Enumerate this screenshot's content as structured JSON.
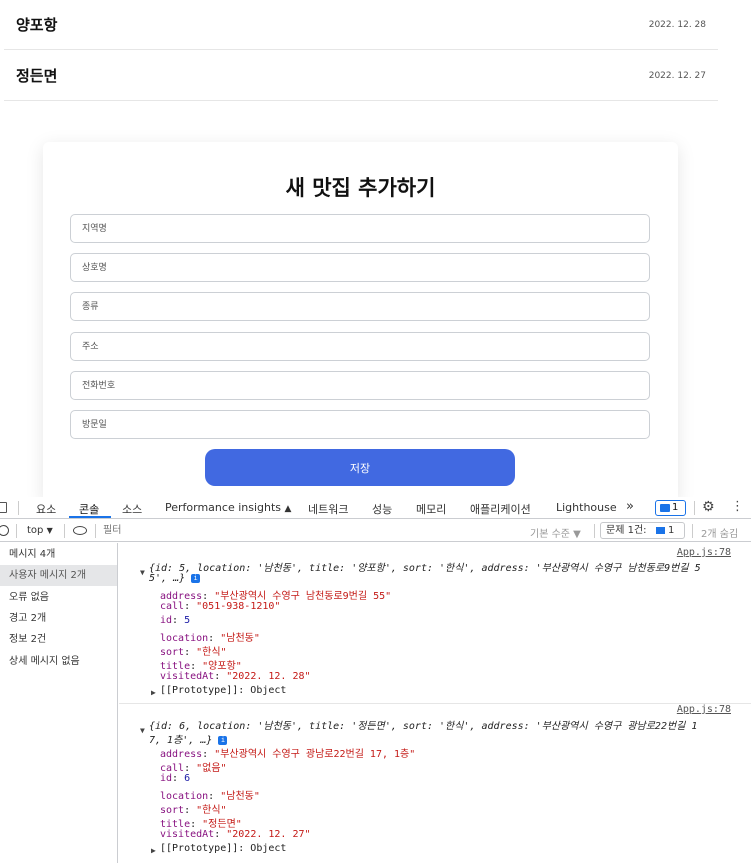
{
  "restaurants": [
    {
      "name": "양포항",
      "date": "2022. 12. 28"
    },
    {
      "name": "정든면",
      "date": "2022. 12. 27"
    }
  ],
  "form": {
    "title": "새 맛집 추가하기",
    "fields": [
      {
        "placeholder": "지역명"
      },
      {
        "placeholder": "상호명"
      },
      {
        "placeholder": "종류"
      },
      {
        "placeholder": "주소"
      },
      {
        "placeholder": "전화번호"
      },
      {
        "placeholder": "방문일"
      }
    ],
    "save_label": "저장",
    "accent": "#4169e1"
  },
  "devtools": {
    "tabs": [
      "요소",
      "콘솔",
      "소스",
      "Performance insights",
      "네트워크",
      "성능",
      "메모리",
      "애플리케이션",
      "Lighthouse"
    ],
    "active_tab": "콘솔",
    "more_tabs_glyph": "»",
    "badge_count": "1",
    "toolbar": {
      "context": "top",
      "filter_placeholder": "필터",
      "levels": "기본 수준 ▼",
      "issues_label": "문제 1건:",
      "issues_count": "1",
      "hidden": "2개 숨김"
    },
    "sidebar": [
      {
        "label": "메시지 4개",
        "selected": false
      },
      {
        "label": "사용자 메시지 2개",
        "selected": true
      },
      {
        "label": "오류 없음",
        "selected": false
      },
      {
        "label": "경고 2개",
        "selected": false
      },
      {
        "label": "정보 2건",
        "selected": false
      },
      {
        "label": "상세 메시지 없음",
        "selected": false
      }
    ],
    "logs": [
      {
        "source": "App.js:78",
        "summary_line1": "{id: 5, location: '남천동', title: '양포항', sort: '한식', address: '부산광역시 수영구 남천동로9번길 5",
        "summary_line2": "5', …}",
        "props": [
          {
            "key": "address",
            "value": "\"부산광역시 수영구 남천동로9번길 55\"",
            "kind": "str"
          },
          {
            "key": "call",
            "value": "\"051-938-1210\"",
            "kind": "str"
          },
          {
            "key": "id",
            "value": "5",
            "kind": "num"
          },
          {
            "key": "location",
            "value": "\"남천동\"",
            "kind": "str"
          },
          {
            "key": "sort",
            "value": "\"한식\"",
            "kind": "str"
          },
          {
            "key": "title",
            "value": "\"양포항\"",
            "kind": "str"
          },
          {
            "key": "visitedAt",
            "value": "\"2022. 12. 28\"",
            "kind": "str"
          }
        ],
        "prototype": "[[Prototype]]: Object"
      },
      {
        "source": "App.js:78",
        "summary_line1": "{id: 6, location: '남천동', title: '정든면', sort: '한식', address: '부산광역시 수영구 광남로22번길 1",
        "summary_line2": "7, 1층', …}",
        "props": [
          {
            "key": "address",
            "value": "\"부산광역시 수영구 광남로22번길 17, 1층\"",
            "kind": "str"
          },
          {
            "key": "call",
            "value": "\"없음\"",
            "kind": "str"
          },
          {
            "key": "id",
            "value": "6",
            "kind": "num"
          },
          {
            "key": "location",
            "value": "\"남천동\"",
            "kind": "str"
          },
          {
            "key": "sort",
            "value": "\"한식\"",
            "kind": "str"
          },
          {
            "key": "title",
            "value": "\"정든면\"",
            "kind": "str"
          },
          {
            "key": "visitedAt",
            "value": "\"2022. 12. 27\"",
            "kind": "str"
          }
        ],
        "prototype": "[[Prototype]]: Object"
      }
    ]
  }
}
